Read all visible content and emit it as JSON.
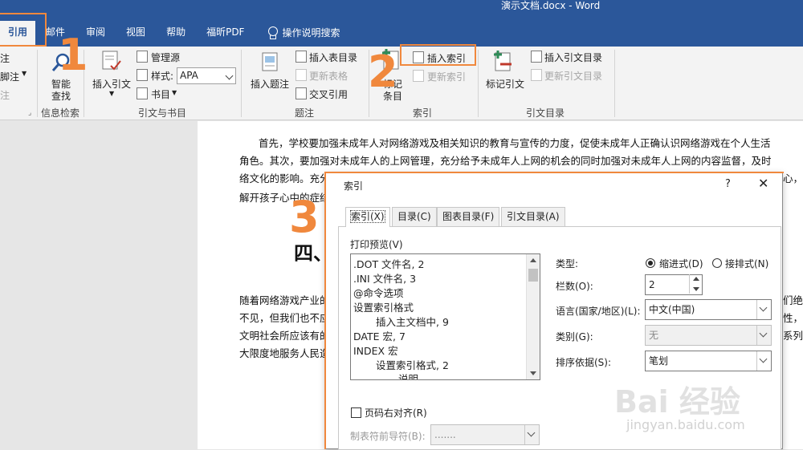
{
  "window": {
    "title": "演示文档.docx  -  Word"
  },
  "tabs": [
    "引用",
    "邮件",
    "审阅",
    "视图",
    "帮助",
    "福昕PDF"
  ],
  "tell_me": "操作说明搜索",
  "ribbon": {
    "left_partial": [
      "注",
      "脚注",
      "注"
    ],
    "research": {
      "button": "智能\n查找",
      "button_l1": "智能",
      "button_l2": "查找",
      "group": "信息检索"
    },
    "citations": {
      "insert_citation": "插入引文",
      "manage_sources": "管理源",
      "style_label": "样式:",
      "style_value": "APA",
      "bibliography": "书目",
      "group": "引文与书目"
    },
    "captions": {
      "insert_caption": "插入题注",
      "insert_table_of_figures": "插入表目录",
      "update_table": "更新表格",
      "cross_reference": "交叉引用",
      "group": "题注"
    },
    "index": {
      "mark_entry_l1": "标记",
      "mark_entry_l2": "条目",
      "insert_index": "插入索引",
      "update_index": "更新索引",
      "group": "索引"
    },
    "toa": {
      "mark_citation": "标记引文",
      "insert_toa": "插入引文目录",
      "update_toa": "更新引文目录",
      "group": "引文目录"
    }
  },
  "document": {
    "lines": [
      "首先，学校要加强未成年人对网络游戏及相关知识的教育与宣传的力度，促使未成年人正确认识网络游戏在个人生活",
      "角色。其次，要加强对未成年人的上网管理，充分给予未成年人上网的机会的同时加强对未成年人上网的内容监督，及时",
      "络文化的影响。充分",
      "解开孩子心中的症结"
    ],
    "line3_tail": "心，",
    "heading": "四、",
    "lines2": [
      "随着网络游戏产业的",
      "不见，但我们也不应",
      "文明社会所应该有的",
      "大限度地服务人民造"
    ],
    "lines2_tails": [
      "们绝",
      "性，",
      "系列"
    ]
  },
  "dialog": {
    "title": "索引",
    "help": "?",
    "tabs": [
      "索引(X)",
      "目录(C)",
      "图表目录(F)",
      "引文目录(A)"
    ],
    "print_preview_label": "打印预览(V)",
    "preview_lines": [
      ".DOT  文件名, 2",
      ".INI  文件名, 3",
      "@命令选项",
      "设置索引格式",
      "插入主文档中, 9",
      "DATE  宏, 7",
      "INDEX  宏",
      "设置索引格式, 2",
      "说明"
    ],
    "type_label": "类型:",
    "type_options": [
      "缩进式(D)",
      "接排式(N)"
    ],
    "columns_label": "栏数(O):",
    "columns_value": "2",
    "language_label": "语言(国家/地区)(L):",
    "language_value": "中文(中国)",
    "category_label": "类别(G):",
    "category_value": "无",
    "sort_label": "排序依据(S):",
    "sort_value": "笔划",
    "right_align_label": "页码右对齐(R)",
    "tab_leader_label": "制表符前导符(B):",
    "tab_leader_value": "......."
  },
  "annotations": [
    "1",
    "2",
    "3"
  ],
  "watermark": {
    "main": "Bai 经验",
    "sub": "jingyan.baidu.com"
  },
  "colors": {
    "word_blue": "#2b579a",
    "annotation": "#f0883d",
    "ribbon_bg": "#f3f3f3"
  }
}
